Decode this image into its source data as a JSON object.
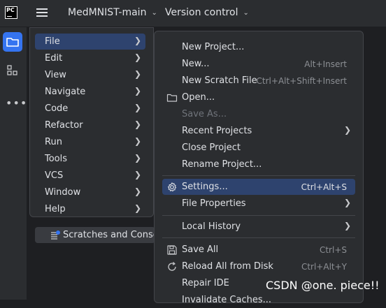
{
  "titlebar": {
    "logo_text": "PC",
    "project_name": "MedMNIST-main",
    "version_control": "Version control"
  },
  "toolwindows": {
    "icons": [
      "folder-icon",
      "structure-icon",
      "more-icon"
    ]
  },
  "main_menu": {
    "items": [
      {
        "label": "File",
        "selected": true
      },
      {
        "label": "Edit"
      },
      {
        "label": "View"
      },
      {
        "label": "Navigate"
      },
      {
        "label": "Code"
      },
      {
        "label": "Refactor"
      },
      {
        "label": "Run"
      },
      {
        "label": "Tools"
      },
      {
        "label": "VCS"
      },
      {
        "label": "Window"
      },
      {
        "label": "Help"
      }
    ]
  },
  "file_menu": {
    "items": [
      {
        "label": "New Project...",
        "shortcut": ""
      },
      {
        "label": "New...",
        "shortcut": "Alt+Insert"
      },
      {
        "label": "New Scratch File",
        "shortcut": "Ctrl+Alt+Shift+Insert"
      },
      {
        "label": "Open...",
        "icon": "folder-icon"
      },
      {
        "label": "Save As...",
        "disabled": true
      },
      {
        "label": "Recent Projects",
        "submenu": true
      },
      {
        "label": "Close Project"
      },
      {
        "label": "Rename Project..."
      },
      {
        "label": "Settings...",
        "shortcut": "Ctrl+Alt+S",
        "icon": "gear-icon",
        "selected": true
      },
      {
        "label": "File Properties",
        "submenu": true
      },
      {
        "label": "Local History",
        "submenu": true
      },
      {
        "label": "Save All",
        "shortcut": "Ctrl+S",
        "icon": "save-icon"
      },
      {
        "label": "Reload All from Disk",
        "shortcut": "Ctrl+Alt+Y",
        "icon": "reload-icon"
      },
      {
        "label": "Repair IDE"
      },
      {
        "label": "Invalidate Caches..."
      }
    ]
  },
  "project_tree": {
    "scratches_label": "Scratches and Consoles"
  },
  "watermark": "CSDN @one. piece!!",
  "colors": {
    "accent": "#3574f0",
    "selection": "#2e436e",
    "background": "#1e1f22",
    "panel": "#2b2d30"
  }
}
